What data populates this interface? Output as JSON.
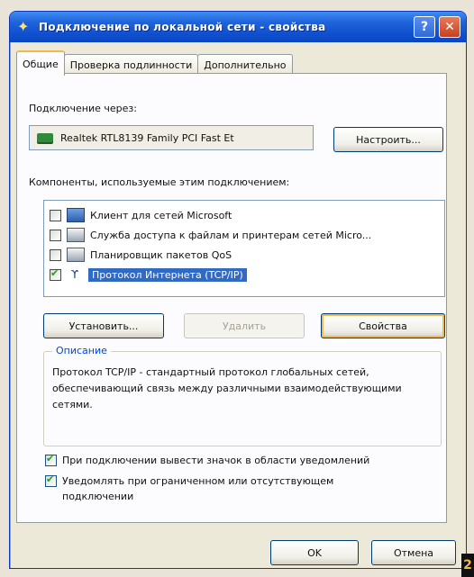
{
  "window": {
    "title": "Подключение по локальной сети - свойства",
    "help_label": "?",
    "close_label": "✕"
  },
  "tabs": [
    {
      "label": "Общие"
    },
    {
      "label": "Проверка подлинности"
    },
    {
      "label": "Дополнительно"
    }
  ],
  "connect_using": {
    "label": "Подключение через:",
    "adapter": "Realtek RTL8139 Family PCI Fast Et",
    "configure_label": "Настроить..."
  },
  "components": {
    "label": "Компоненты, используемые этим подключением:",
    "items": [
      {
        "label": "Клиент для сетей Microsoft",
        "checked": false,
        "icon": "computer-icon"
      },
      {
        "label": "Служба доступа к файлам и принтерам сетей Micro...",
        "checked": false,
        "icon": "printer-icon"
      },
      {
        "label": "Планировщик пакетов QoS",
        "checked": false,
        "icon": "printer-icon"
      },
      {
        "label": "Протокол Интернета (TCP/IP)",
        "checked": true,
        "icon": "network-protocol-icon",
        "selected": true
      }
    ]
  },
  "buttons": {
    "install": "Установить...",
    "uninstall": "Удалить",
    "properties": "Свойства",
    "ok": "OK",
    "cancel": "Отмена"
  },
  "description": {
    "title": "Описание",
    "text": "Протокол TCP/IP - стандартный протокол глобальных сетей, обеспечивающий связь между различными взаимодействующими сетями."
  },
  "options": [
    {
      "label": "При подключении вывести значок в области уведомлений",
      "checked": true
    },
    {
      "label": "Уведомлять при ограниченном или отсутствующем подключении",
      "checked": true
    }
  ],
  "badge": "2",
  "colors": {
    "titlebar": "#0f4fcf",
    "selection": "#316ac5",
    "group_title": "#0046d5"
  }
}
